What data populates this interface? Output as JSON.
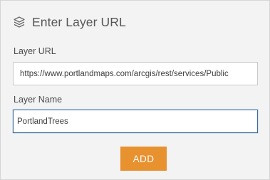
{
  "header": {
    "icon": "layers-icon",
    "title": "Enter Layer URL"
  },
  "form": {
    "url_label": "Layer URL",
    "url_value": "https://www.portlandmaps.com/arcgis/rest/services/Public",
    "name_label": "Layer Name",
    "name_value": "PortlandTrees"
  },
  "actions": {
    "add_label": "ADD"
  },
  "colors": {
    "panel_bg": "#f3f3f3",
    "accent_button": "#e8912f",
    "focus_border": "#3a6fa0"
  }
}
